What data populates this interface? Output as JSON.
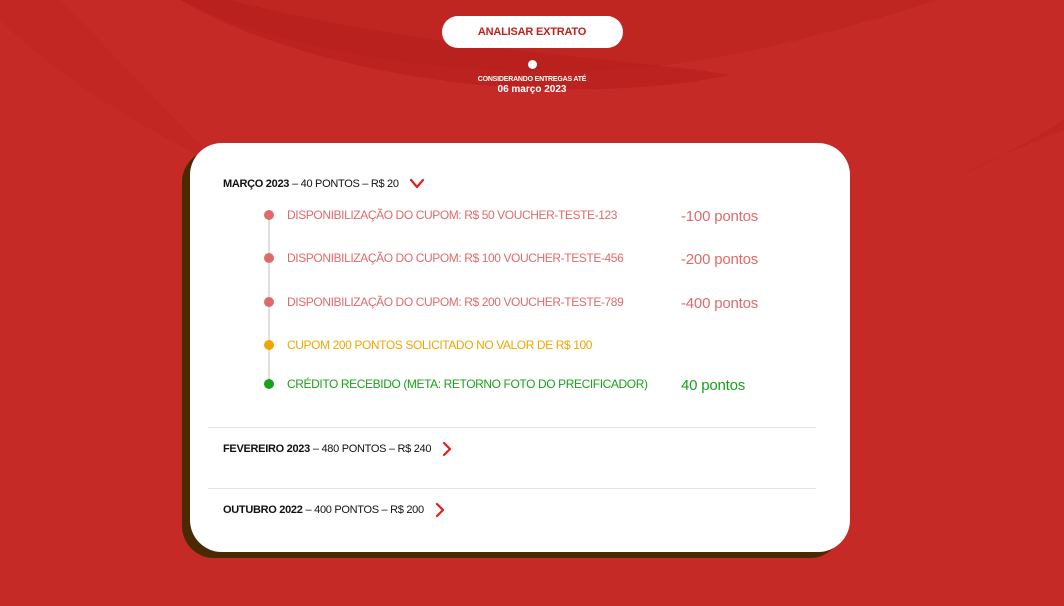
{
  "header": {
    "analyze_button": "ANALISAR EXTRATO",
    "considering_label": "CONSIDERANDO ENTREGAS ATÉ",
    "date": "06 março 2023"
  },
  "colors": {
    "background": "#c52a26",
    "debit": "#e06a6a",
    "pending": "#f0a500",
    "credit": "#1aa01a",
    "accent": "#e0201e"
  },
  "months": [
    {
      "name": "MARÇO 2023",
      "summary": "– 40 PONTOS – R$ 20",
      "expanded": true,
      "chevron_icon": "chevron-down-icon",
      "entries": [
        {
          "text": "DISPONIBILIZAÇÃO DO CUPOM: R$ 50 VOUCHER-TESTE-123",
          "points": "-100 pontos",
          "status": "debit"
        },
        {
          "text": "DISPONIBILIZAÇÃO DO CUPOM: R$ 100 VOUCHER-TESTE-456",
          "points": "-200 pontos",
          "status": "debit"
        },
        {
          "text": "DISPONIBILIZAÇÃO DO CUPOM: R$ 200 VOUCHER-TESTE-789",
          "points": "-400 pontos",
          "status": "debit"
        },
        {
          "text": "CUPOM 200 PONTOS SOLICITADO NO VALOR DE R$ 100",
          "points": "",
          "status": "pending"
        },
        {
          "text": "CRÉDITO RECEBIDO (META: RETORNO FOTO DO PRECIFICADOR)",
          "points": "40 pontos",
          "status": "credit"
        }
      ]
    },
    {
      "name": "FEVEREIRO 2023",
      "summary": "– 480 PONTOS – R$ 240",
      "expanded": false,
      "chevron_icon": "chevron-right-icon"
    },
    {
      "name": "OUTUBRO 2022",
      "summary": "– 400 PONTOS – R$ 200",
      "expanded": false,
      "chevron_icon": "chevron-right-icon"
    }
  ]
}
